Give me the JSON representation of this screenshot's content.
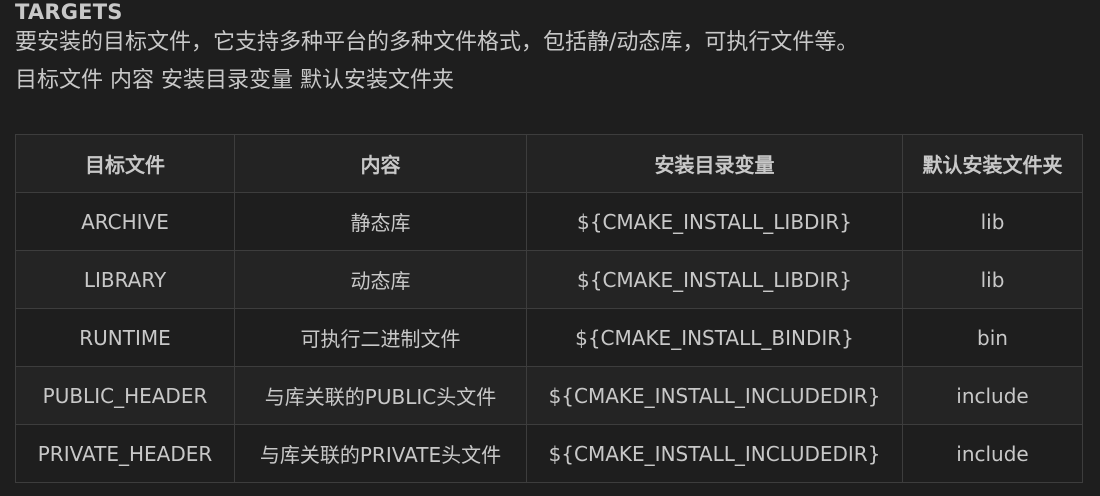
{
  "section": {
    "title": "TARGETS",
    "description": "要安装的目标文件，它支持多种平台的多种文件格式，包括静/动态库，可执行文件等。",
    "summary": "目标文件 内容 安装目录变量 默认安装文件夹"
  },
  "table": {
    "headers": [
      "目标文件",
      "内容",
      "安装目录变量",
      "默认安装文件夹"
    ],
    "rows": [
      [
        "ARCHIVE",
        "静态库",
        "${CMAKE_INSTALL_LIBDIR}",
        "lib"
      ],
      [
        "LIBRARY",
        "动态库",
        "${CMAKE_INSTALL_LIBDIR}",
        "lib"
      ],
      [
        "RUNTIME",
        "可执行二进制文件",
        "${CMAKE_INSTALL_BINDIR}",
        "bin"
      ],
      [
        "PUBLIC_HEADER",
        "与库关联的PUBLIC头文件",
        "${CMAKE_INSTALL_INCLUDEDIR}",
        "include"
      ],
      [
        "PRIVATE_HEADER",
        "与库关联的PRIVATE头文件",
        "${CMAKE_INSTALL_INCLUDEDIR}",
        "include"
      ]
    ]
  }
}
